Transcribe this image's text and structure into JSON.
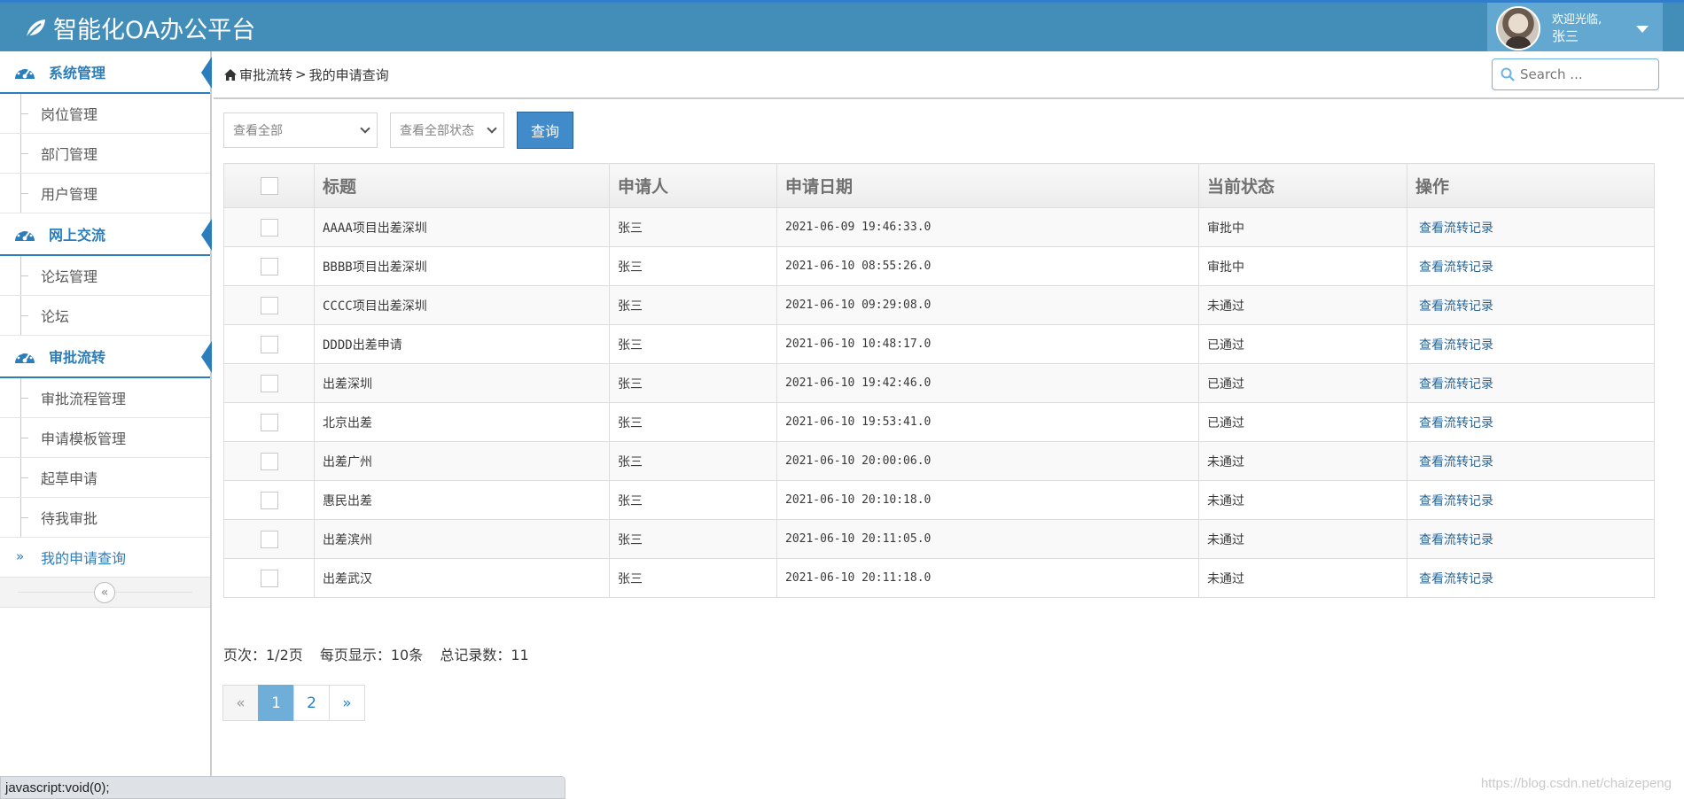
{
  "app": {
    "title": "智能化OA办公平台",
    "user_greeting": "欢迎光临,",
    "user_name": "张三"
  },
  "sidebar": {
    "groups": [
      {
        "label": "系统管理",
        "items": [
          {
            "label": "岗位管理"
          },
          {
            "label": "部门管理"
          },
          {
            "label": "用户管理"
          }
        ]
      },
      {
        "label": "网上交流",
        "items": [
          {
            "label": "论坛管理"
          },
          {
            "label": "论坛"
          }
        ]
      },
      {
        "label": "审批流转",
        "items": [
          {
            "label": "审批流程管理"
          },
          {
            "label": "申请模板管理"
          },
          {
            "label": "起草申请"
          },
          {
            "label": "待我审批"
          },
          {
            "label": "我的申请查询",
            "active": true
          }
        ]
      }
    ]
  },
  "breadcrumb": {
    "parent": "审批流转",
    "separator": ">",
    "current": "我的申请查询"
  },
  "search": {
    "placeholder": "Search ..."
  },
  "filters": {
    "template_select": "查看全部",
    "status_select": "查看全部状态",
    "query_button": "查询"
  },
  "table": {
    "headers": {
      "title": "标题",
      "applicant": "申请人",
      "date": "申请日期",
      "status": "当前状态",
      "action": "操作"
    },
    "rows": [
      {
        "title": "AAAA项目出差深圳",
        "applicant": "张三",
        "date": "2021-06-09 19:46:33.0",
        "status": "审批中",
        "action": "查看流转记录"
      },
      {
        "title": "BBBB项目出差深圳",
        "applicant": "张三",
        "date": "2021-06-10 08:55:26.0",
        "status": "审批中",
        "action": "查看流转记录"
      },
      {
        "title": "CCCC项目出差深圳",
        "applicant": "张三",
        "date": "2021-06-10 09:29:08.0",
        "status": "未通过",
        "action": "查看流转记录"
      },
      {
        "title": "DDDD出差申请",
        "applicant": "张三",
        "date": "2021-06-10 10:48:17.0",
        "status": "已通过",
        "action": "查看流转记录"
      },
      {
        "title": "出差深圳",
        "applicant": "张三",
        "date": "2021-06-10 19:42:46.0",
        "status": "已通过",
        "action": "查看流转记录"
      },
      {
        "title": "北京出差",
        "applicant": "张三",
        "date": "2021-06-10 19:53:41.0",
        "status": "已通过",
        "action": "查看流转记录"
      },
      {
        "title": "出差广州",
        "applicant": "张三",
        "date": "2021-06-10 20:00:06.0",
        "status": "未通过",
        "action": "查看流转记录"
      },
      {
        "title": "惠民出差",
        "applicant": "张三",
        "date": "2021-06-10 20:10:18.0",
        "status": "未通过",
        "action": "查看流转记录"
      },
      {
        "title": "出差滨州",
        "applicant": "张三",
        "date": "2021-06-10 20:11:05.0",
        "status": "未通过",
        "action": "查看流转记录"
      },
      {
        "title": "出差武汉",
        "applicant": "张三",
        "date": "2021-06-10 20:11:18.0",
        "status": "未通过",
        "action": "查看流转记录"
      }
    ]
  },
  "pagination": {
    "page_info": "页次：1/2页",
    "per_page": "每页显示：10条",
    "total": "总记录数：11",
    "prev": "«",
    "pages": [
      "1",
      "2"
    ],
    "next": "»"
  },
  "statusbar": {
    "text": "javascript:void(0);"
  },
  "watermark": "https://blog.csdn.net/chaizepeng",
  "colors": {
    "navbar": "#438eb9",
    "accent": "#2b7dbc",
    "user_box": "#62a8d1",
    "active_page": "#6faed9"
  },
  "icons": {
    "brand": "leaf-icon",
    "menu": "dashboard-icon",
    "home": "home-icon",
    "search": "search-icon",
    "collapse": "double-chevron-left-icon"
  }
}
